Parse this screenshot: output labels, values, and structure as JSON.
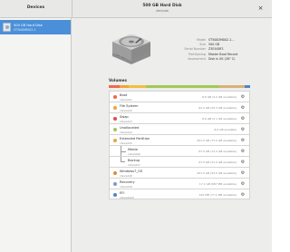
{
  "header": {
    "sidebar_title": "Devices",
    "title": "500 GB Hard Disk",
    "subtitle": "/dev/sda",
    "close_glyph": "×"
  },
  "sidebar": {
    "devices": [
      {
        "name": "500 GB Hard Disk",
        "model": "ST500DM002-1"
      }
    ]
  },
  "info": [
    {
      "key": "Model",
      "value": "ST500DM002-1..."
    },
    {
      "key": "Size",
      "value": "500 GB"
    },
    {
      "key": "Serial Number",
      "value": "Z3E4X8F1"
    },
    {
      "key": "Partitioning",
      "value": "Master Boot Record"
    },
    {
      "key": "Assessment",
      "value": "Disk is OK (28° C)"
    }
  ],
  "volumes_title": "Volumes",
  "partition_bar": [
    {
      "color": "#ee6b4a",
      "fraction": 0.08
    },
    {
      "color": "#f2a33a",
      "fraction": 0.06
    },
    {
      "color": "#efc040",
      "fraction": 0.12
    },
    {
      "color": "#a4c853",
      "fraction": 0.52
    },
    {
      "color": "#d9b07a",
      "fraction": 0.18
    },
    {
      "color": "#4f86c6",
      "fraction": 0.04
    }
  ],
  "volumes": [
    {
      "name": "Boot",
      "fs": "/dev/sda1",
      "usage": "8.6 GB (4.2 GB available)",
      "color": "#e76a47",
      "icon": "gear-icon",
      "nested": false
    },
    {
      "name": "File System",
      "fs": "/dev/sda2",
      "usage": "64.4 GB (20.3 GB available)",
      "color": "#f0a33c",
      "icon": "gear-icon",
      "nested": false
    },
    {
      "name": "Swap",
      "fs": "/dev/sda3",
      "usage": "8.6 GB (2.1 GB available)",
      "color": "#e04d4d",
      "icon": "gear-icon",
      "nested": false
    },
    {
      "name": "Unallocated",
      "fs": "/dev/sda4",
      "usage": "8.6 GB available",
      "color": "#a8c25a",
      "icon": "gear-icon",
      "nested": false
    },
    {
      "name": "Extended Partition",
      "fs": "/dev/sda5",
      "usage": "201.5 GB (77.5 GB available)",
      "color": "#f0a33c",
      "icon": "gear-icon",
      "nested": false
    },
    {
      "name": "Media",
      "fs": "/dev/sda6",
      "usage": "97.5 GB (12.3 GB available)",
      "color": "",
      "icon": "gear-icon",
      "nested": true,
      "cont": true
    },
    {
      "name": "Backup",
      "fs": "/dev/sda7",
      "usage": "97.5 GB (21.0 GB available)",
      "color": "",
      "icon": "gear-icon",
      "nested": true,
      "cont": false
    },
    {
      "name": "Windows7_OS",
      "fs": "/dev/sda8",
      "usage": "201.5 GB (93.0 GB available)",
      "color": "#e38a3a",
      "icon": "gear-icon",
      "nested": false
    },
    {
      "name": "Recovery",
      "fs": "/dev/sda9",
      "usage": "17.1 GB (687 MB available)",
      "color": "#7a9ac8",
      "icon": "gear-icon",
      "nested": false
    },
    {
      "name": "EFI",
      "fs": "/dev/sda10",
      "usage": "100 MB (77.1 MB available)",
      "color": "#4f86c6",
      "icon": "gear-icon",
      "nested": false
    }
  ]
}
